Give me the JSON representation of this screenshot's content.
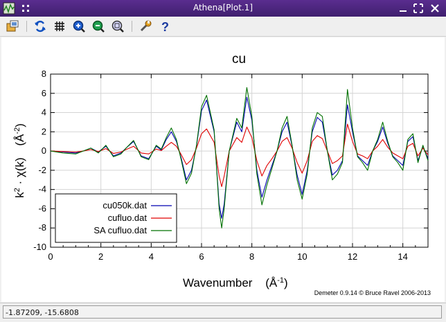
{
  "window": {
    "title": "Athena[Plot.1]"
  },
  "status": {
    "coords": "-1.87209, -15.6808"
  },
  "credit": "Demeter 0.9.14 © Bruce Ravel 2006-2013",
  "chart_data": {
    "type": "line",
    "title": "cu",
    "xlabel": "Wavenumber",
    "xlabel_unit": "(Å",
    "xlabel_unit_exp": "-1",
    "xlabel_unit_close": ")",
    "ylabel_main": "k",
    "ylabel_exp": "2",
    "ylabel_rest": " · χ(k)",
    "ylabel_unit": "(Å",
    "ylabel_unit_exp": "-2",
    "ylabel_unit_close": ")",
    "xlim": [
      0,
      15
    ],
    "ylim": [
      -10,
      8
    ],
    "xticks": [
      0,
      2,
      4,
      6,
      8,
      10,
      12,
      14
    ],
    "yticks": [
      8,
      6,
      4,
      2,
      0,
      -2,
      -4,
      -6,
      -8,
      -10
    ],
    "grid": true,
    "legend_position": "bottom-left",
    "series": [
      {
        "name": "cu050k.dat",
        "color": "#0000b0",
        "x": [
          0,
          0.5,
          1,
          1.3,
          1.6,
          1.9,
          2.2,
          2.5,
          2.8,
          3,
          3.3,
          3.6,
          3.9,
          4.2,
          4.4,
          4.6,
          4.8,
          5.0,
          5.2,
          5.4,
          5.6,
          5.8,
          6.0,
          6.2,
          6.5,
          6.7,
          6.8,
          6.9,
          7.1,
          7.4,
          7.6,
          7.8,
          8.0,
          8.2,
          8.4,
          8.6,
          8.8,
          9.0,
          9.2,
          9.4,
          9.6,
          9.8,
          10.0,
          10.2,
          10.4,
          10.6,
          10.8,
          11.0,
          11.2,
          11.4,
          11.6,
          11.8,
          12.0,
          12.2,
          12.4,
          12.6,
          12.8,
          13.0,
          13.2,
          13.4,
          13.6,
          13.8,
          14.0,
          14.2,
          14.4,
          14.6,
          14.8,
          15.0
        ],
        "y": [
          0,
          -0.1,
          -0.2,
          0,
          0.3,
          -0.1,
          0.5,
          -0.5,
          -0.2,
          0.3,
          1.0,
          -0.5,
          -0.8,
          0.5,
          0.1,
          1.2,
          2.0,
          1.0,
          -0.8,
          -3.0,
          -2.0,
          0.5,
          4.2,
          5.3,
          2.0,
          -5.5,
          -7.0,
          -5.5,
          0,
          3.0,
          2.0,
          5.6,
          3.2,
          -2.0,
          -4.8,
          -3.0,
          -1.5,
          0,
          2.0,
          3.0,
          0.5,
          -2.5,
          -4.5,
          -2.0,
          2.0,
          3.5,
          3.0,
          0,
          -2.5,
          -2.0,
          -1.0,
          4.8,
          2.0,
          -0.5,
          -1.0,
          -1.5,
          0,
          1.0,
          2.5,
          0.8,
          -0.5,
          -1.0,
          -1.5,
          1.0,
          1.5,
          -1.0,
          0.5,
          -0.8
        ]
      },
      {
        "name": "cufluo.dat",
        "color": "#e00000",
        "x": [
          0,
          0.5,
          1,
          1.3,
          1.6,
          1.9,
          2.2,
          2.5,
          2.8,
          3,
          3.3,
          3.6,
          3.9,
          4.2,
          4.4,
          4.6,
          4.8,
          5.0,
          5.2,
          5.4,
          5.6,
          5.8,
          6.0,
          6.2,
          6.5,
          6.7,
          6.8,
          6.9,
          7.1,
          7.4,
          7.6,
          7.8,
          8.0,
          8.2,
          8.4,
          8.6,
          8.8,
          9.0,
          9.2,
          9.4,
          9.6,
          9.8,
          10.0,
          10.2,
          10.4,
          10.6,
          10.8,
          11.0,
          11.2,
          11.4,
          11.6,
          11.8,
          12.0,
          12.2,
          12.4,
          12.6,
          12.8,
          13.0,
          13.2,
          13.4,
          13.6,
          13.8,
          14.0,
          14.2,
          14.4,
          14.6,
          14.8,
          15.0
        ],
        "y": [
          0,
          -0.05,
          -0.1,
          0,
          0.15,
          -0.05,
          0.25,
          -0.25,
          -0.1,
          0.15,
          0.5,
          -0.2,
          -0.3,
          0.2,
          0.05,
          0.5,
          0.9,
          0.5,
          -0.4,
          -1.4,
          -0.9,
          0.3,
          1.8,
          2.3,
          0.9,
          -2.6,
          -3.7,
          -2.6,
          0,
          1.4,
          0.9,
          2.5,
          1.4,
          -1.0,
          -2.6,
          -1.5,
          -0.8,
          0,
          1.0,
          1.4,
          0.3,
          -1.2,
          -2.3,
          -1.0,
          1.0,
          1.6,
          1.3,
          0,
          -1.3,
          -1.0,
          -0.5,
          2.8,
          1.0,
          -0.3,
          -0.5,
          -0.8,
          0,
          0.5,
          1.2,
          0.4,
          -0.2,
          -0.5,
          -0.8,
          0.5,
          0.8,
          -0.5,
          0.3,
          -0.4
        ]
      },
      {
        "name": "SA  cufluo.dat",
        "color": "#007000",
        "x": [
          0,
          0.5,
          1,
          1.3,
          1.6,
          1.9,
          2.2,
          2.5,
          2.8,
          3,
          3.3,
          3.6,
          3.9,
          4.2,
          4.4,
          4.6,
          4.8,
          5.0,
          5.2,
          5.4,
          5.6,
          5.8,
          6.0,
          6.2,
          6.5,
          6.7,
          6.8,
          6.9,
          7.1,
          7.4,
          7.6,
          7.8,
          8.0,
          8.2,
          8.4,
          8.6,
          8.8,
          9.0,
          9.2,
          9.4,
          9.6,
          9.8,
          10.0,
          10.2,
          10.4,
          10.6,
          10.8,
          11.0,
          11.2,
          11.4,
          11.6,
          11.8,
          12.0,
          12.2,
          12.4,
          12.6,
          12.8,
          13.0,
          13.2,
          13.4,
          13.6,
          13.8,
          14.0,
          14.2,
          14.4,
          14.6,
          14.8,
          15.0
        ],
        "y": [
          0,
          -0.2,
          -0.3,
          0,
          0.3,
          -0.2,
          0.6,
          -0.6,
          -0.3,
          0.3,
          1.1,
          -0.6,
          -0.9,
          0.6,
          0.2,
          1.4,
          2.4,
          1.2,
          -1.0,
          -3.4,
          -2.3,
          0.6,
          4.6,
          5.8,
          2.2,
          -6.0,
          -8.0,
          -6.0,
          0,
          3.4,
          2.4,
          6.6,
          3.6,
          -2.4,
          -5.6,
          -3.5,
          -1.8,
          0,
          2.4,
          3.6,
          0.6,
          -3.0,
          -5.0,
          -2.4,
          2.4,
          4.0,
          3.6,
          0,
          -3.0,
          -2.4,
          -1.2,
          6.4,
          2.4,
          -0.6,
          -1.2,
          -2.0,
          0,
          1.2,
          3.0,
          1.0,
          -0.6,
          -1.2,
          -2.0,
          1.2,
          1.8,
          -1.2,
          0.6,
          -1.0
        ]
      }
    ]
  }
}
